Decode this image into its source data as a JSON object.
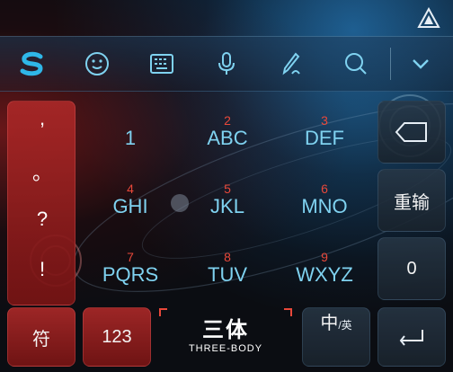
{
  "toolbar": {
    "icons": [
      "sogou-s-icon",
      "emoji-icon",
      "keyboard-icon",
      "microphone-icon",
      "handwriting-icon",
      "search-icon",
      "chevron-down-icon"
    ]
  },
  "punct_keys": [
    ",",
    "。",
    "?",
    "!"
  ],
  "digit_keys": [
    {
      "sub": "",
      "main": "1"
    },
    {
      "sub": "2",
      "main": "ABC"
    },
    {
      "sub": "3",
      "main": "DEF"
    },
    {
      "sub": "4",
      "main": "GHI"
    },
    {
      "sub": "5",
      "main": "JKL"
    },
    {
      "sub": "6",
      "main": "MNO"
    },
    {
      "sub": "7",
      "main": "PQRS"
    },
    {
      "sub": "8",
      "main": "TUV"
    },
    {
      "sub": "9",
      "main": "WXYZ"
    }
  ],
  "right_keys": {
    "retype": "重输",
    "zero": "0"
  },
  "bottom": {
    "symbol": "符",
    "num": "123",
    "space_logo": "三体",
    "space_sub": "THREE-BODY",
    "lang_main": "中",
    "lang_sub": "/英"
  },
  "colors": {
    "accent_red": "#e8483a",
    "accent_cyan": "#7fd2f0"
  }
}
